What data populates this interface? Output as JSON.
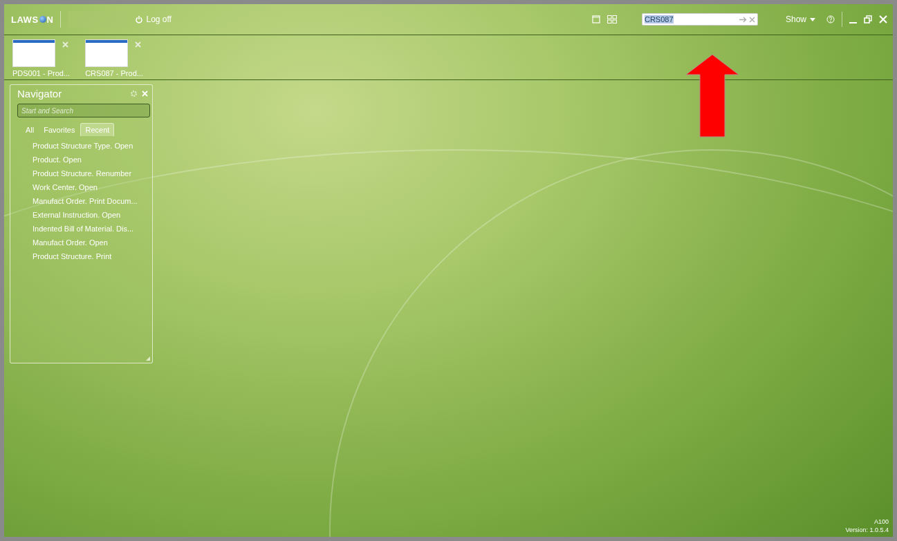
{
  "header": {
    "logo": {
      "before": "LAWS",
      "after": "N"
    },
    "logoff": "Log off",
    "search": {
      "value": "CRS087",
      "selected": true
    },
    "show": "Show"
  },
  "open_windows": [
    {
      "label": "PDS001 - Prod..."
    },
    {
      "label": "CRS087 - Prod..."
    }
  ],
  "navigator": {
    "title": "Navigator",
    "search": {
      "placeholder": "Start and Search"
    },
    "tabs": [
      {
        "label": "All",
        "selected": false
      },
      {
        "label": "Favorites",
        "selected": false
      },
      {
        "label": "Recent",
        "selected": true
      }
    ],
    "items": [
      "Product Structure Type. Open",
      "Product. Open",
      "Product Structure. Renumber",
      "Work Center. Open",
      "Manufact Order. Print Docum...",
      "External Instruction. Open",
      "Indented Bill of Material. Dis...",
      "Manufact Order. Open",
      "Product Structure. Print"
    ]
  },
  "footer": {
    "code": "A100",
    "version": "Version: 1.0.5.4"
  }
}
